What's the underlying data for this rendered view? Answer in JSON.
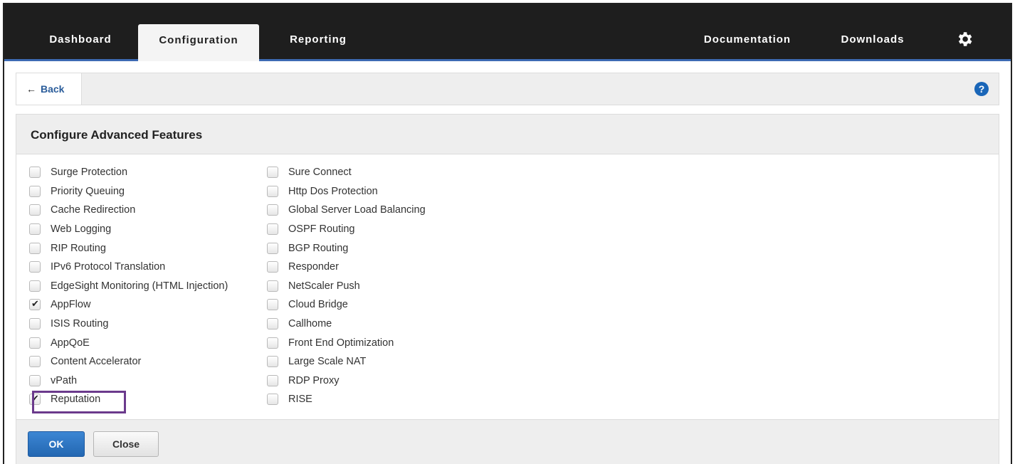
{
  "nav": {
    "tabs": [
      {
        "label": "Dashboard",
        "active": false
      },
      {
        "label": "Configuration",
        "active": true
      },
      {
        "label": "Reporting",
        "active": false
      }
    ],
    "right": [
      "Documentation",
      "Downloads"
    ],
    "gear_icon": "gear-icon"
  },
  "backbar": {
    "back_label": "Back",
    "help_glyph": "?"
  },
  "panel": {
    "title": "Configure Advanced Features",
    "col1": [
      {
        "label": "Surge Protection",
        "checked": false
      },
      {
        "label": "Priority Queuing",
        "checked": false
      },
      {
        "label": "Cache Redirection",
        "checked": false
      },
      {
        "label": "Web Logging",
        "checked": false
      },
      {
        "label": "RIP Routing",
        "checked": false
      },
      {
        "label": "IPv6 Protocol Translation",
        "checked": false
      },
      {
        "label": "EdgeSight Monitoring (HTML Injection)",
        "checked": false
      },
      {
        "label": "AppFlow",
        "checked": true
      },
      {
        "label": "ISIS Routing",
        "checked": false
      },
      {
        "label": "AppQoE",
        "checked": false
      },
      {
        "label": "Content Accelerator",
        "checked": false
      },
      {
        "label": "vPath",
        "checked": false
      },
      {
        "label": "Reputation",
        "checked": true
      }
    ],
    "col2": [
      {
        "label": "Sure Connect",
        "checked": false
      },
      {
        "label": "Http Dos Protection",
        "checked": false
      },
      {
        "label": "Global Server Load Balancing",
        "checked": false
      },
      {
        "label": "OSPF Routing",
        "checked": false
      },
      {
        "label": "BGP Routing",
        "checked": false
      },
      {
        "label": "Responder",
        "checked": false
      },
      {
        "label": "NetScaler Push",
        "checked": false
      },
      {
        "label": "Cloud Bridge",
        "checked": false
      },
      {
        "label": "Callhome",
        "checked": false
      },
      {
        "label": "Front End Optimization",
        "checked": false
      },
      {
        "label": "Large Scale NAT",
        "checked": false
      },
      {
        "label": "RDP Proxy",
        "checked": false
      },
      {
        "label": "RISE",
        "checked": false
      }
    ]
  },
  "footer": {
    "ok_label": "OK",
    "close_label": "Close"
  },
  "colors": {
    "accent": "#3d6ab3",
    "highlight": "#6b3a8c",
    "ok_button": "#2367b2"
  }
}
